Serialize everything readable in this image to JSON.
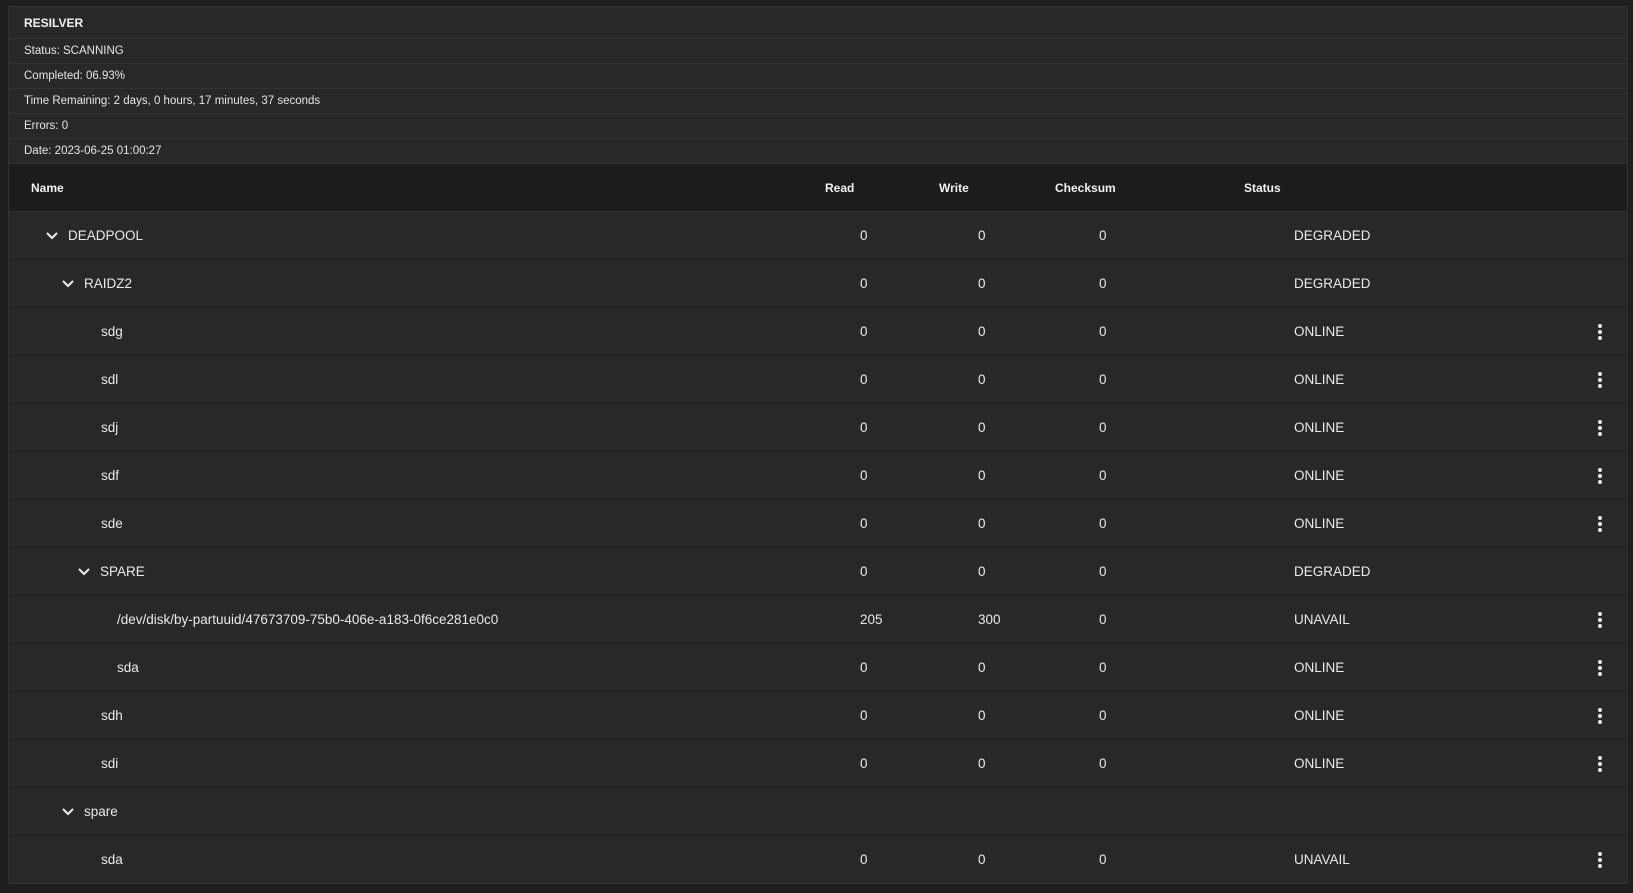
{
  "resilver": {
    "title": "RESILVER",
    "status": "Status: SCANNING",
    "completed": "Completed: 06.93%",
    "time_remaining": "Time Remaining:  2 days,  0 hours,  17 minutes,  37 seconds",
    "errors": "Errors: 0",
    "date": "Date: 2023-06-25 01:00:27"
  },
  "table": {
    "headers": {
      "name": "Name",
      "read": "Read",
      "write": "Write",
      "checksum": "Checksum",
      "status": "Status"
    },
    "rows": [
      {
        "name": "DEADPOOL",
        "read": "0",
        "write": "0",
        "checksum": "0",
        "status": "DEGRADED",
        "level": 0,
        "expandable": true,
        "menu": false
      },
      {
        "name": "RAIDZ2",
        "read": "0",
        "write": "0",
        "checksum": "0",
        "status": "DEGRADED",
        "level": 1,
        "expandable": true,
        "menu": false
      },
      {
        "name": "sdg",
        "read": "0",
        "write": "0",
        "checksum": "0",
        "status": "ONLINE",
        "level": 2,
        "expandable": false,
        "menu": true
      },
      {
        "name": "sdl",
        "read": "0",
        "write": "0",
        "checksum": "0",
        "status": "ONLINE",
        "level": 2,
        "expandable": false,
        "menu": true
      },
      {
        "name": "sdj",
        "read": "0",
        "write": "0",
        "checksum": "0",
        "status": "ONLINE",
        "level": 2,
        "expandable": false,
        "menu": true
      },
      {
        "name": "sdf",
        "read": "0",
        "write": "0",
        "checksum": "0",
        "status": "ONLINE",
        "level": 2,
        "expandable": false,
        "menu": true
      },
      {
        "name": "sde",
        "read": "0",
        "write": "0",
        "checksum": "0",
        "status": "ONLINE",
        "level": 2,
        "expandable": false,
        "menu": true
      },
      {
        "name": "SPARE",
        "read": "0",
        "write": "0",
        "checksum": "0",
        "status": "DEGRADED",
        "level": 2,
        "expandable": true,
        "menu": false
      },
      {
        "name": "/dev/disk/by-partuuid/47673709-75b0-406e-a183-0f6ce281e0c0",
        "read": "205",
        "write": "300",
        "checksum": "0",
        "status": "UNAVAIL",
        "level": 3,
        "expandable": false,
        "menu": true
      },
      {
        "name": "sda",
        "read": "0",
        "write": "0",
        "checksum": "0",
        "status": "ONLINE",
        "level": 3,
        "expandable": false,
        "menu": true
      },
      {
        "name": "sdh",
        "read": "0",
        "write": "0",
        "checksum": "0",
        "status": "ONLINE",
        "level": 2,
        "expandable": false,
        "menu": true
      },
      {
        "name": "sdi",
        "read": "0",
        "write": "0",
        "checksum": "0",
        "status": "ONLINE",
        "level": 2,
        "expandable": false,
        "menu": true
      },
      {
        "name": "spare",
        "read": "",
        "write": "",
        "checksum": "",
        "status": "",
        "level": 1,
        "expandable": true,
        "menu": false
      },
      {
        "name": "sda",
        "read": "0",
        "write": "0",
        "checksum": "0",
        "status": "UNAVAIL",
        "level": 2,
        "expandable": false,
        "menu": true
      }
    ]
  },
  "icons": {
    "expand": "chevron-down-icon",
    "menu": "more-vertical-icon"
  },
  "colors": {
    "background": "#1e1e1e",
    "card": "#282828",
    "header": "#1c1c1c",
    "text": "#eaeaea"
  }
}
